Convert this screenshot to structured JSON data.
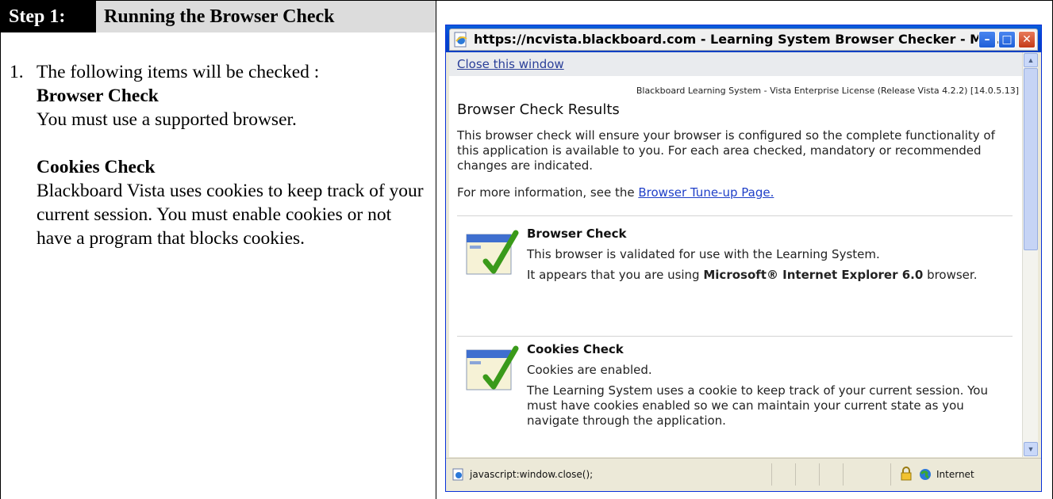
{
  "doc": {
    "step_label": "Step 1:",
    "step_title": "Running the Browser Check",
    "item_number": "1.",
    "intro": "The following items will be checked :",
    "browser_check_heading": "Browser Check",
    "browser_check_text": "You must use a supported browser.",
    "cookies_check_heading": "Cookies Check",
    "cookies_check_text": "Blackboard Vista uses cookies to keep track of your current session. You must enable cookies or not have a program that blocks cookies."
  },
  "window": {
    "title": "https://ncvista.blackboard.com - Learning System Browser Checker - Mi...",
    "minimize_label": "–",
    "maximize_label": "□",
    "close_label": "✕"
  },
  "page": {
    "close_link": "Close this window",
    "license": "Blackboard Learning System - Vista Enterprise License (Release Vista 4.2.2) [14.0.5.13]",
    "results_title": "Browser Check Results",
    "intro": "This browser check will ensure your browser is configured so the complete functionality of this application is available to you. For each area checked, mandatory or recommended changes are indicated.",
    "more_info_prefix": "For more information, see the ",
    "more_info_link": "Browser Tune-up Page.",
    "checks": [
      {
        "title": "Browser Check",
        "line1": "This browser is validated for use with the Learning System.",
        "line2_prefix": "It appears that you are using ",
        "line2_bold": "Microsoft® Internet Explorer 6.0",
        "line2_suffix": " browser."
      },
      {
        "title": "Cookies Check",
        "line1": "Cookies are enabled.",
        "line2": "The Learning System uses a cookie to keep track of your current session. You must have cookies enabled so we can maintain your current state as you navigate through the application."
      }
    ]
  },
  "status": {
    "text": "javascript:window.close();",
    "zone": "Internet"
  },
  "colors": {
    "xp_titlebar": "#0046d5",
    "link": "#1f3fc8",
    "check_green": "#3a9a1a"
  }
}
